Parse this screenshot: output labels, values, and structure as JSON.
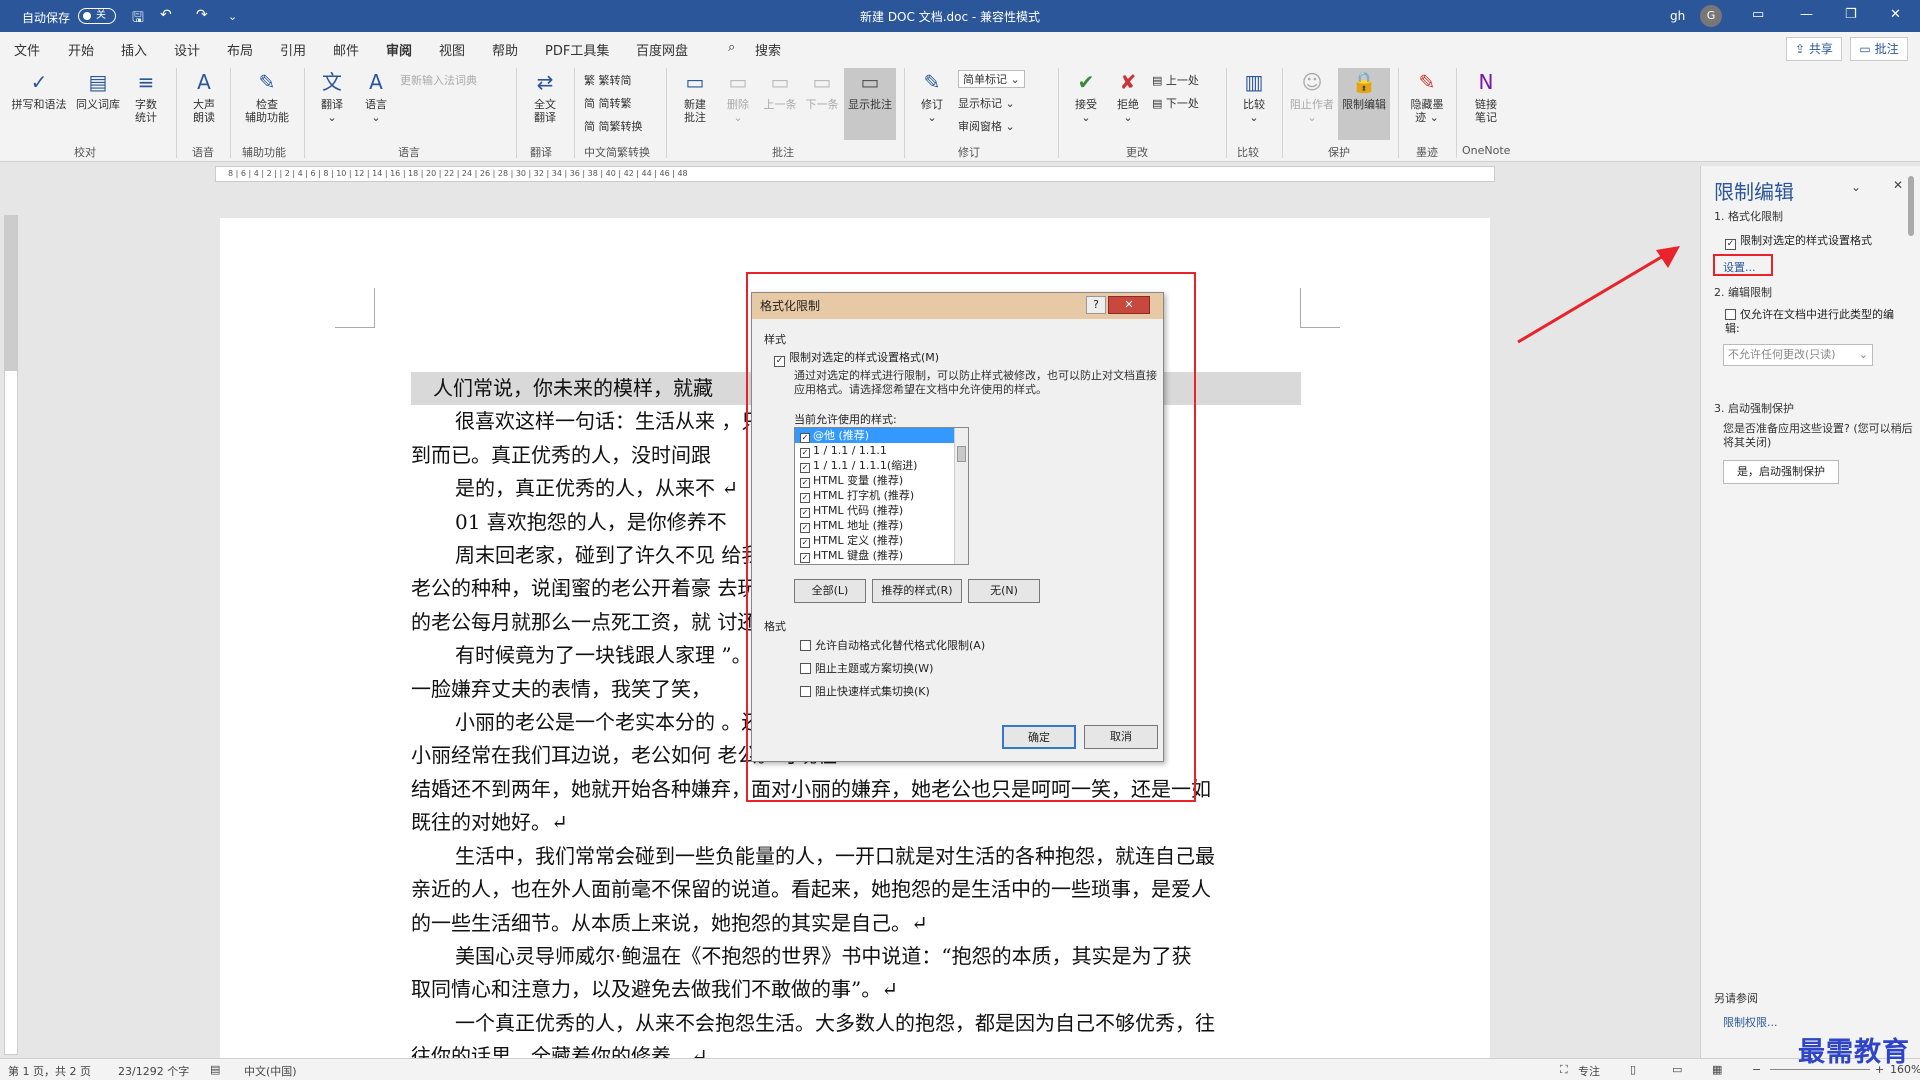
{
  "titlebar": {
    "autosave_label": "自动保存",
    "autosave_state": "关",
    "doc_title": "新建 DOC 文档.doc  -  兼容性模式",
    "user_name": "gh",
    "avatar_letter": "G"
  },
  "menu": [
    "文件",
    "开始",
    "插入",
    "设计",
    "布局",
    "引用",
    "邮件",
    "审阅",
    "视图",
    "帮助",
    "PDF工具集",
    "百度网盘",
    "搜索"
  ],
  "menu_active": "审阅",
  "share_label": "共享",
  "comment_label": "批注",
  "ribbon": {
    "spell": "拼写和语法",
    "thesaurus": "同义词库",
    "wordcount": [
      "字数",
      "统计"
    ],
    "readaloud": [
      "大声",
      "朗读"
    ],
    "checkaccess": [
      "检查",
      "辅助功能"
    ],
    "translate": "翻译",
    "language": "语言",
    "ime_dict": "更新输入法词典",
    "fulltrans": [
      "全文",
      "翻译"
    ],
    "trad2simp": "繁转简",
    "simp2trad": "简转繁",
    "conv": "简繁转换",
    "newcomment": [
      "新建",
      "批注"
    ],
    "delete": "删除",
    "prev": "上一条",
    "next": "下一条",
    "showcomments": "显示批注",
    "track": "修订",
    "simplemarkup": "简单标记",
    "showmarkup": "显示标记",
    "reviewpane": "审阅窗格",
    "accept": "接受",
    "reject": "拒绝",
    "prevchange": "上一处",
    "nextchange": "下一处",
    "compare": "比较",
    "blockauthors": "阻止作者",
    "restrict": "限制编辑",
    "hideink": [
      "隐藏墨",
      "迹"
    ],
    "linknotes": [
      "链接",
      "笔记"
    ],
    "groups": {
      "proof": "校对",
      "speech": "语音",
      "access": "辅助功能",
      "lang": "语言",
      "trans": "翻译",
      "chinese": "中文简繁转换",
      "comments": "批注",
      "tracking": "修订",
      "changes": "更改",
      "compare": "比较",
      "protect": "保护",
      "ink": "墨迹",
      "onenote": "OneNote"
    }
  },
  "ruler_numbers": "8 | 6 | 4 | 2 |   | 2 | 4 | 6 | 8 | 10 | 12 | 14 | 16 | 18 | 20 | 22 | 24 | 26 | 28 | 30 | 32 | 34 | 36 | 38 | 40 | 42 | 44 | 46 | 48",
  "document": {
    "lines": [
      "人们常说，你未来的模样，就藏",
      "很喜欢这样一句话：生活从来                                              ，只是你没有",
      "到而已。真正优秀的人，没时间跟",
      "是的，真正优秀的人，从来不                                                    ↵",
      "01  喜欢抱怨的人，是你修养不",
      "周末回老家，碰到了许久不见                                              给我抱怨自己",
      "老公的种种，说闺蜜的老公开着豪                                            去玩。而自己",
      "的老公每月就那么一点死工资，就                                          讨还价。↵",
      "有时候竟为了一块钱跟人家理                                              ”。看着小丽",
      "一脸嫌弃丈夫的表情，我笑了笑，",
      "小丽的老公是一个老实本分的                                              。还记得当初",
      "小丽经常在我们耳边说，老公如何                                          老公。可现在",
      "结婚还不到两年，她就开始各种嫌弃，面对小丽的嫌弃，她老公也只是呵呵一笑，还是一如",
      "既往的对她好。↵",
      "生活中，我们常常会碰到一些负能量的人，一开口就是对生活的各种抱怨，就连自己最",
      "亲近的人，也在外人面前毫不保留的说道。看起来，她抱怨的是生活中的一些琐事，是爱人",
      "的一些生活细节。从本质上来说，她抱怨的其实是自己。↵",
      "美国心灵导师威尔·鲍温在《不抱怨的世界》书中说道：“抱怨的本质，其实是为了获",
      "取同情心和注意力，以及避免去做我们不敢做的事”。↵",
      "一个真正优秀的人，从来不会抱怨生活。大多数人的抱怨，都是因为自己不够优秀，往",
      "往你的话里，全藏着你的修养。↵"
    ]
  },
  "dialog": {
    "title": "格式化限制",
    "help": "?",
    "close": "✕",
    "section_styles": "样式",
    "limit_check": "限制对选定的样式设置格式(M)",
    "description": "通过对选定的样式进行限制，可以防止样式被修改，也可以防止对文档直接应用格式。请选择您希望在文档中允许使用的样式。",
    "allowed_label": "当前允许使用的样式:",
    "styles": [
      "@他 (推荐)",
      "1 / 1.1 / 1.1.1",
      "1 / 1.1 / 1.1.1(缩进)",
      "HTML 变量 (推荐)",
      "HTML 打字机 (推荐)",
      "HTML 代码 (推荐)",
      "HTML 地址 (推荐)",
      "HTML 定义 (推荐)",
      "HTML 键盘 (推荐)"
    ],
    "btn_all": "全部(L)",
    "btn_recommended": "推荐的样式(R)",
    "btn_none": "无(N)",
    "section_format": "格式",
    "opt1": "允许自动格式化替代格式化限制(A)",
    "opt2": "阻止主题或方案切换(W)",
    "opt3": "阻止快速样式集切换(K)",
    "ok": "确定",
    "cancel": "取消"
  },
  "pane": {
    "title": "限制编辑",
    "step1": "1. 格式化限制",
    "step1_check": "限制对选定的样式设置格式",
    "settings_link": "设置...",
    "step2": "2. 编辑限制",
    "step2_check": "仅允许在文档中进行此类型的编辑:",
    "step2_dd": "不允许任何更改(只读)",
    "step3": "3. 启动强制保护",
    "step3_desc": "您是否准备应用这些设置? (您可以稍后将其关闭)",
    "step3_btn": "是，启动强制保护",
    "see_also": "另请参阅",
    "permission_link": "限制权限..."
  },
  "status": {
    "page": "第 1 页，共 2 页",
    "words": "23/1292 个字",
    "lang": "中文(中国)",
    "focus": "专注",
    "zoom": "160%"
  },
  "watermark": "最需教育"
}
